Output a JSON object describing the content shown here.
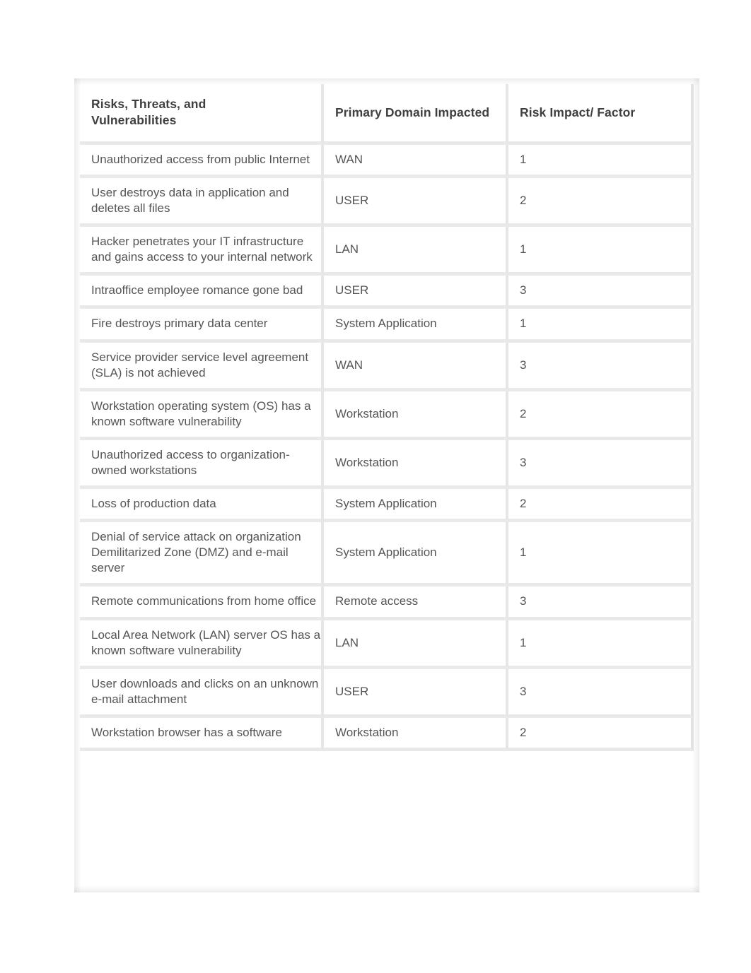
{
  "table": {
    "headers": [
      "Risks, Threats, and Vulnerabilities",
      "Primary Domain Impacted",
      "Risk Impact/ Factor"
    ],
    "header_line1": "Risks, Threats, and",
    "header_line2": "Vulnerabilities",
    "rows": [
      {
        "risk": "Unauthorized access from public Internet",
        "domain": "WAN",
        "factor": "1"
      },
      {
        "risk": "User destroys data in application and deletes all files",
        "domain": "USER",
        "factor": "2"
      },
      {
        "risk": "Hacker penetrates your IT infrastructure and gains access to your internal network",
        "domain": "LAN",
        "factor": "1"
      },
      {
        "risk": "Intraoffice employee romance gone bad",
        "domain": "USER",
        "factor": "3"
      },
      {
        "risk": "Fire destroys primary data center",
        "domain": "System Application",
        "factor": "1"
      },
      {
        "risk": "Service provider service level agreement (SLA) is not achieved",
        "domain": "WAN",
        "factor": "3"
      },
      {
        "risk": "Workstation operating system (OS) has a known software vulnerability",
        "domain": "Workstation",
        "factor": "2"
      },
      {
        "risk": "Unauthorized access to organization-owned workstations",
        "domain": "Workstation",
        "factor": "3"
      },
      {
        "risk": "Loss of production data",
        "domain": "System Application",
        "factor": "2"
      },
      {
        "risk": "Denial of service attack on organization Demilitarized Zone (DMZ) and e-mail server",
        "domain": "System Application",
        "factor": "1"
      },
      {
        "risk": "Remote communications from home office",
        "domain": "Remote access",
        "factor": "3"
      },
      {
        "risk": "Local Area Network (LAN) server OS has a known software vulnerability",
        "domain": "LAN",
        "factor": "1"
      },
      {
        "risk": "User downloads and clicks on an unknown e-mail attachment",
        "domain": "USER",
        "factor": "3"
      },
      {
        "risk": "Workstation browser has a software",
        "domain": "Workstation",
        "factor": "2"
      }
    ]
  },
  "colors": {
    "page_background": "#ffffff",
    "cell_background": "#ffffff",
    "grid_line": "#e6e6e6",
    "header_text": "#3f3f3f",
    "body_text": "#555555",
    "emphasis_text": "#1b1b1b"
  }
}
